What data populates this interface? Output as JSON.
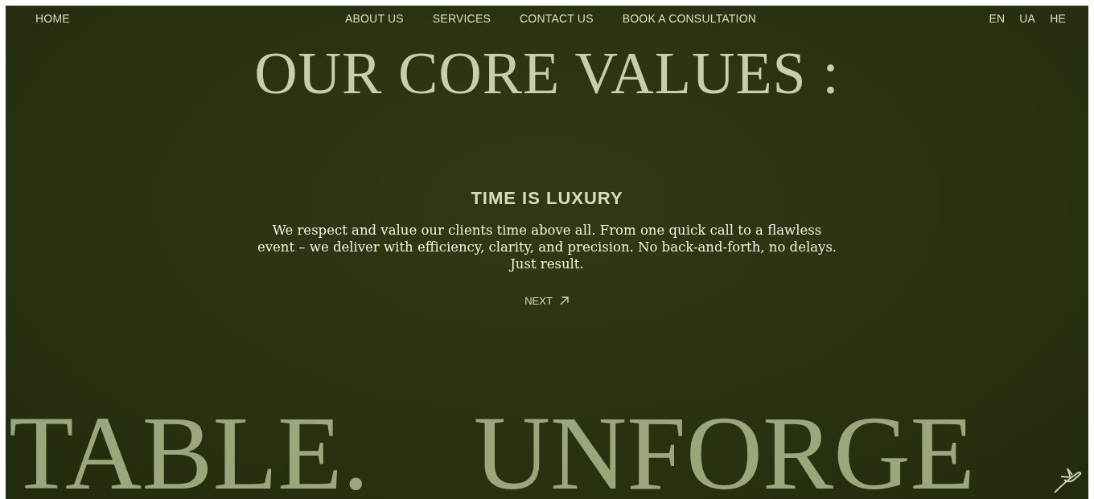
{
  "nav": {
    "home": "HOME",
    "links": [
      "ABOUT US",
      "SERVICES",
      "CONTACT US",
      "BOOK A CONSULTATION"
    ],
    "languages": [
      "EN",
      "UA",
      "HE"
    ]
  },
  "heading": "OUR CORE VALUES :",
  "value": {
    "title": "TIME IS LUXURY",
    "text": "We respect and value our clients time above all. From one quick call to a flawless event – we deliver with efficiency, clarity, and precision. No back-and-forth, no delays. Just result.",
    "next": "NEXT"
  },
  "marquee": [
    "TABLE.",
    "UNFORGE"
  ]
}
